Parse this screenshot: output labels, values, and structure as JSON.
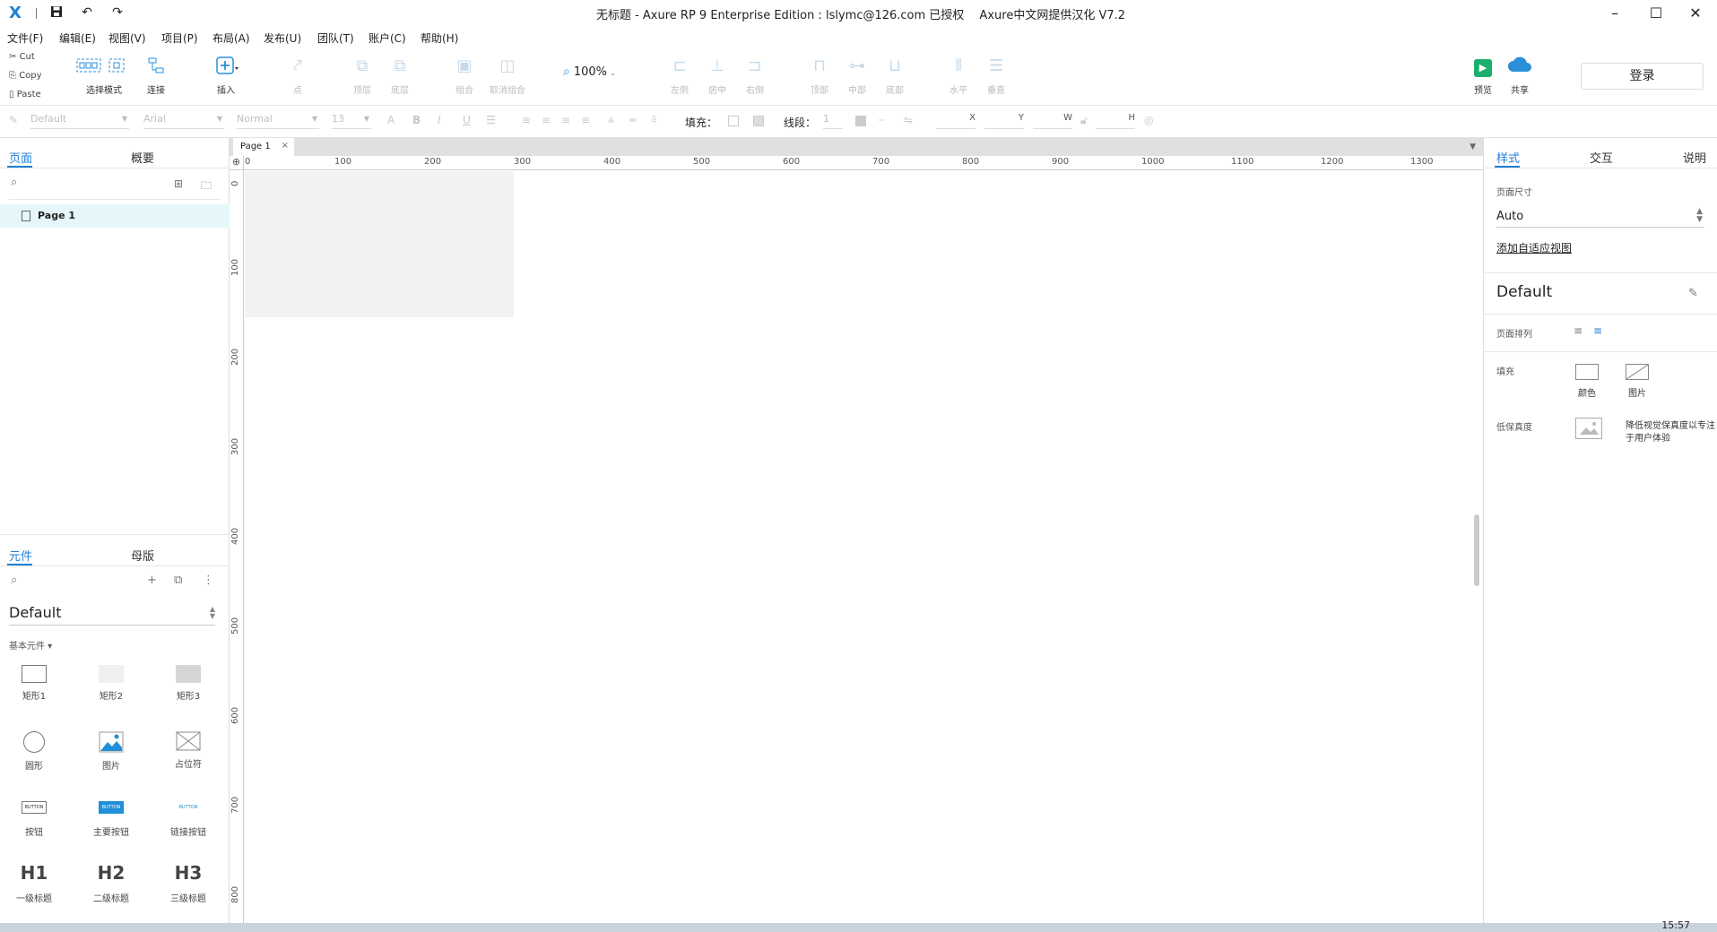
{
  "app": {
    "title": "无标题 - Axure RP 9 Enterprise Edition : lslymc@126.com 已授权　 Axure中文网提供汉化 V7.2",
    "logo": "X"
  },
  "window_controls": {
    "minimize": "–",
    "maximize": "☐",
    "close": "✕"
  },
  "menu": [
    "文件(F)",
    "编辑(E)",
    "视图(V)",
    "项目(P)",
    "布局(A)",
    "发布(U)",
    "团队(T)",
    "账户(C)",
    "帮助(H)"
  ],
  "clipboard": {
    "cut": "Cut",
    "copy": "Copy",
    "paste": "Paste"
  },
  "toolbar": {
    "select_mode": "选择模式",
    "connect": "连接",
    "insert": "插入",
    "point": "点",
    "top_layer": "顶层",
    "bottom_layer": "底层",
    "group": "组合",
    "ungroup": "取消组合",
    "zoom": "100%",
    "align_left": "左侧",
    "align_center": "居中",
    "align_right": "右侧",
    "align_top": "顶部",
    "align_middle": "中部",
    "align_bottom": "底部",
    "dist_h": "水平",
    "dist_v": "垂直",
    "preview": "预览",
    "share": "共享",
    "login": "登录"
  },
  "format": {
    "style": "Default",
    "font": "Arial",
    "weight": "Normal",
    "size": "13",
    "fill_label": "填充：",
    "line_label": "线段：",
    "line_value": "1",
    "x": "X",
    "y": "Y",
    "w": "W",
    "h": "H"
  },
  "left": {
    "tab_pages": "页面",
    "tab_outline": "概要",
    "page1": "Page 1",
    "tab_widgets": "元件",
    "tab_masters": "母版",
    "library": "Default",
    "category": "基本元件 ▾",
    "widgets": [
      {
        "label": "矩形1"
      },
      {
        "label": "矩形2"
      },
      {
        "label": "矩形3"
      },
      {
        "label": "圆形"
      },
      {
        "label": "图片"
      },
      {
        "label": "占位符"
      },
      {
        "label": "按钮",
        "text": "BUTTON"
      },
      {
        "label": "主要按钮",
        "text": "BUTTON"
      },
      {
        "label": "链接按钮",
        "text": "BUTTON"
      },
      {
        "label": "一级标题",
        "text": "H1"
      },
      {
        "label": "二级标题",
        "text": "H2"
      },
      {
        "label": "三级标题",
        "text": "H3"
      }
    ]
  },
  "canvas": {
    "tab": "Page 1",
    "ruler_top": [
      "0",
      "100",
      "200",
      "300",
      "400",
      "500",
      "600",
      "700",
      "800",
      "900",
      "1000",
      "1100",
      "1200",
      "1300"
    ],
    "ruler_left": [
      "0",
      "100",
      "200",
      "300",
      "400",
      "500",
      "600",
      "700",
      "800"
    ]
  },
  "right": {
    "tab_style": "样式",
    "tab_interact": "交互",
    "tab_notes": "说明",
    "page_size_label": "页面尺寸",
    "page_size_value": "Auto",
    "add_adaptive": "添加自适应视图",
    "style_name": "Default",
    "page_align_label": "页面排列",
    "fill_label": "填充",
    "fill_color": "颜色",
    "fill_image": "图片",
    "low_fidelity_label": "低保真度",
    "low_fidelity_desc_1": "降低视觉保真度以专注",
    "low_fidelity_desc_2": "于用户体验"
  },
  "colors": {
    "accent": "#1f7fd4",
    "primary_button": "#1f8fd8",
    "preview": "#1ab06b",
    "page_row": "#e6f7fb"
  },
  "taskbar": {
    "clock": "15:57"
  }
}
